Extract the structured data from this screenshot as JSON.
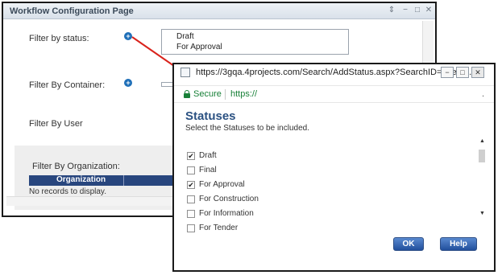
{
  "workflow_window": {
    "title": "Workflow Configuration Page",
    "controls": [
      "⇕",
      "−",
      "□",
      "✕"
    ],
    "filter_status_label": "Filter by status:",
    "selected_statuses": [
      "Draft",
      "For Approval"
    ],
    "filter_container_label": "Filter By Container:",
    "filter_user_label": "Filter By User",
    "filter_org_label": "Filter By Organization:",
    "grid": {
      "column_header": "Organization",
      "empty_text": "No records to display."
    }
  },
  "popup": {
    "url": "https://3gqa.4projects.com/Search/AddStatus.aspx?SearchID=5ee24...",
    "controls": [
      "−",
      "□",
      "✕"
    ],
    "secure_label": "Secure",
    "secure_protocol": "https://",
    "heading": "Statuses",
    "subheading": "Select the Statuses to be included.",
    "options": [
      {
        "label": "Draft",
        "checked": true
      },
      {
        "label": "Final",
        "checked": false
      },
      {
        "label": "For Approval",
        "checked": true
      },
      {
        "label": "For Construction",
        "checked": false
      },
      {
        "label": "For Information",
        "checked": false
      },
      {
        "label": "For Tender",
        "checked": false
      }
    ],
    "ok_label": "OK",
    "help_label": "Help"
  },
  "colors": {
    "accent_blue": "#2b5182",
    "grid_header": "#28467e",
    "secure_green": "#188038",
    "connector_red": "#d9231c"
  }
}
